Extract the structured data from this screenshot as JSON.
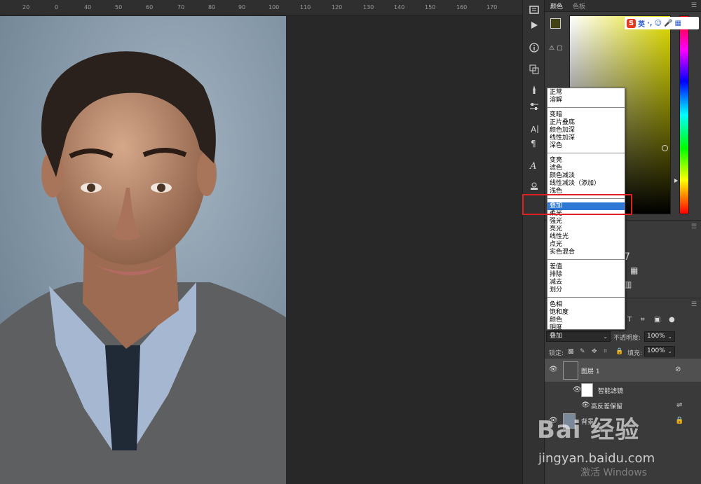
{
  "ruler": {
    "ticks": [
      "20",
      "0",
      "40",
      "50",
      "60",
      "70",
      "80",
      "90",
      "100",
      "110",
      "120",
      "130",
      "140",
      "150",
      "160",
      "170"
    ]
  },
  "panels": {
    "color_tabs": [
      "颜色",
      "色板"
    ],
    "ime": {
      "logo": "S",
      "lang": "英",
      "punct": "·,",
      "emoji": "☺",
      "mic": "🎤",
      "grid": "▦"
    },
    "gamut_warning": "⚠"
  },
  "blend_menu": {
    "groups": [
      [
        "正常",
        "溶解"
      ],
      [
        "变暗",
        "正片叠底",
        "颜色加深",
        "线性加深",
        "深色"
      ],
      [
        "变亮",
        "滤色",
        "颜色减淡",
        "线性减淡（添加）",
        "浅色"
      ],
      [
        "叠加",
        "柔光",
        "强光",
        "亮光",
        "线性光",
        "点光",
        "实色混合"
      ],
      [
        "差值",
        "排除",
        "减去",
        "划分"
      ],
      [
        "色相",
        "饱和度",
        "颜色",
        "明度"
      ]
    ],
    "selected": "叠加"
  },
  "layers": {
    "toolbar": [
      "T",
      "⌗",
      "▣",
      "●"
    ],
    "blend_mode": "叠加",
    "opacity_label": "不透明度:",
    "opacity_value": "100%",
    "lock_label": "锁定:",
    "fill_label": "填充:",
    "fill_value": "100%",
    "items": [
      {
        "name": "图层 1"
      },
      {
        "name": "智能滤镜"
      },
      {
        "name": "高反差保留"
      },
      {
        "name": "背景"
      }
    ]
  },
  "watermark": {
    "logo": "Bai 经验",
    "site": "jingyan.baidu.com"
  },
  "system": {
    "activate": "激活 Windows"
  },
  "colors": {
    "dropdown_selected": "#2f79d6",
    "annotation_box": "#e02020",
    "foreground_swatch": "#434214"
  }
}
